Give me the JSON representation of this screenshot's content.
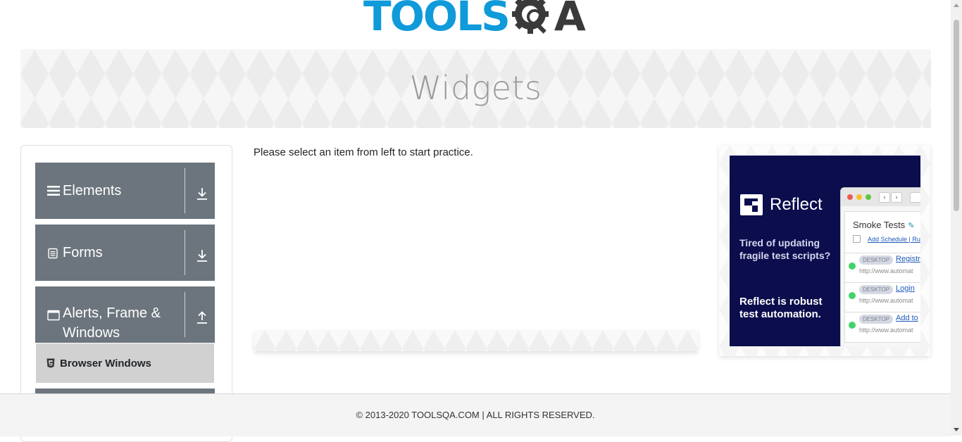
{
  "logo": {
    "text_main": "TOOLS",
    "text_end": "A",
    "colors": {
      "primary": "#0f9ad9",
      "dark": "#3a3a3a"
    }
  },
  "banner": {
    "title": "Widgets"
  },
  "sidebar": {
    "groups": [
      {
        "label": "Elements",
        "icon": "hamburger-icon",
        "toggle_icon": "download-arrow-icon",
        "expanded": false
      },
      {
        "label": "Forms",
        "icon": "form-icon",
        "toggle_icon": "download-arrow-icon",
        "expanded": false
      },
      {
        "label": "Alerts, Frame & Windows",
        "icon": "window-icon",
        "toggle_icon": "upload-arrow-icon",
        "expanded": true,
        "items": [
          {
            "label": "Browser Windows",
            "icon": "html5-icon"
          }
        ]
      }
    ]
  },
  "main": {
    "instruction": "Please select an item from left to start practice."
  },
  "ad": {
    "brand": "Reflect",
    "tagline": "Tired of updating fragile test scripts?",
    "cta": "Reflect is robust test automation.",
    "suite_title": "Smoke Tests",
    "schedule_text": "Add Schedule  |  Ru",
    "rows": [
      {
        "badge": "DESKTOP",
        "test": "Registr",
        "url": "http://www.automat"
      },
      {
        "badge": "DESKTOP",
        "test": "Login",
        "url": "http://www.automat"
      },
      {
        "badge": "DESKTOP",
        "test": "Add to",
        "url": "http://www.automat"
      }
    ]
  },
  "footer": {
    "text": "© 2013-2020 TOOLSQA.COM | ALL RIGHTS RESERVED."
  }
}
